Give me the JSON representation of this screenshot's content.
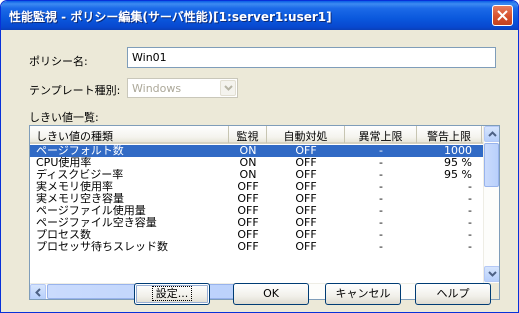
{
  "window": {
    "title": "性能監視 - ポリシー編集(サーバ性能)[1:server1:user1]"
  },
  "form": {
    "policy_name_label": "ポリシー名:",
    "policy_name_value": "Win01",
    "template_label": "テンプレート種別:",
    "template_value": "Windows",
    "threshold_list_label": "しきい値一覧:"
  },
  "table": {
    "columns": [
      "しきい値の種類",
      "監視",
      "自動対処",
      "異常上限",
      "警告上限"
    ],
    "rows": [
      {
        "name": "ページフォルト数",
        "monitor": "ON",
        "auto": "OFF",
        "upper": "-",
        "warn": "1000",
        "selected": true
      },
      {
        "name": "CPU使用率",
        "monitor": "ON",
        "auto": "OFF",
        "upper": "-",
        "warn": "95 %"
      },
      {
        "name": "ディスクビジー率",
        "monitor": "ON",
        "auto": "OFF",
        "upper": "-",
        "warn": "95 %"
      },
      {
        "name": "実メモリ使用率",
        "monitor": "OFF",
        "auto": "OFF",
        "upper": "-",
        "warn": "-"
      },
      {
        "name": "実メモリ空き容量",
        "monitor": "OFF",
        "auto": "OFF",
        "upper": "-",
        "warn": "-"
      },
      {
        "name": "ページファイル使用量",
        "monitor": "OFF",
        "auto": "OFF",
        "upper": "-",
        "warn": "-"
      },
      {
        "name": "ページファイル空き容量",
        "monitor": "OFF",
        "auto": "OFF",
        "upper": "-",
        "warn": "-"
      },
      {
        "name": "プロセス数",
        "monitor": "OFF",
        "auto": "OFF",
        "upper": "-",
        "warn": "-"
      },
      {
        "name": "プロセッサ待ちスレッド数",
        "monitor": "OFF",
        "auto": "OFF",
        "upper": "-",
        "warn": "-"
      }
    ]
  },
  "buttons": {
    "settings": "設定...",
    "ok": "OK",
    "cancel": "キャンセル",
    "help": "ヘルプ"
  },
  "colors": {
    "titlebar": "#0a58dd",
    "selection": "#316ac5",
    "dialog_bg": "#ece9d8"
  }
}
